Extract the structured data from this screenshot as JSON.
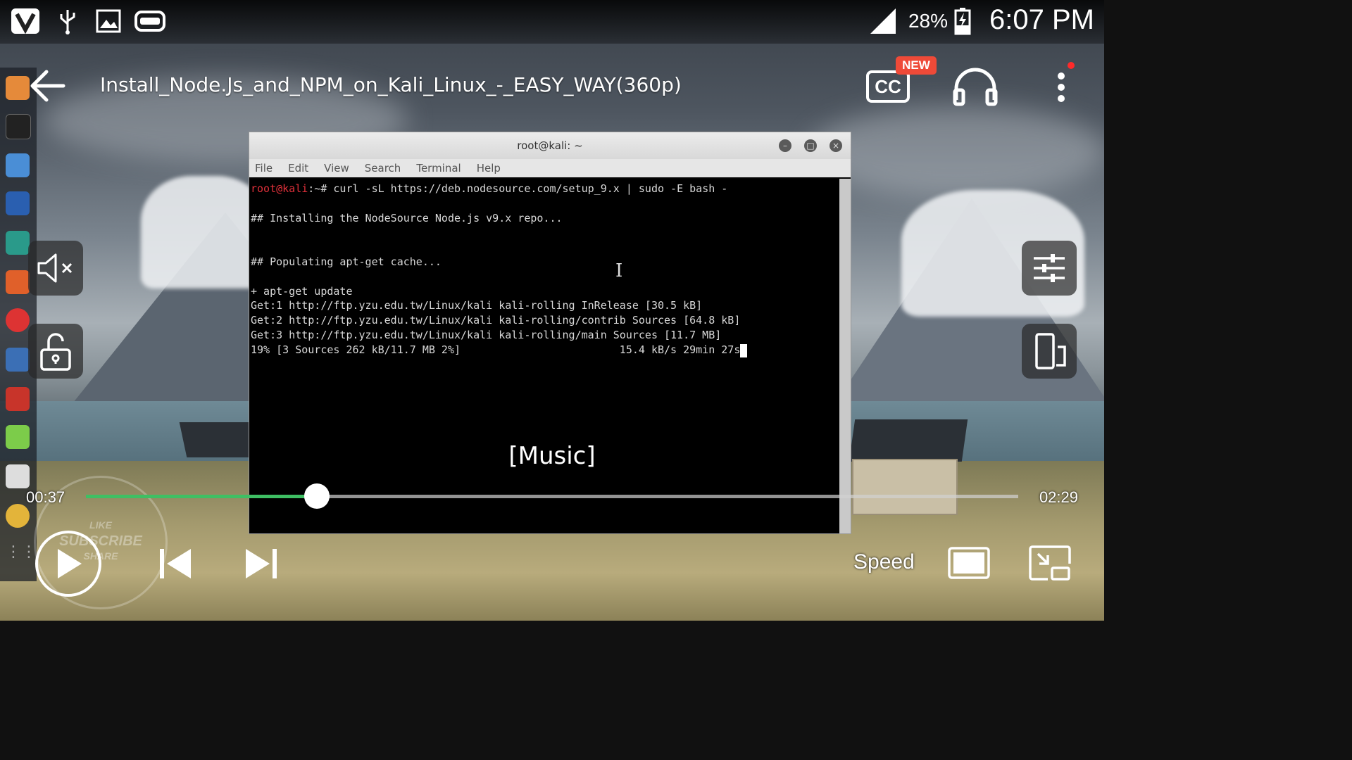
{
  "status_bar": {
    "battery_percent": "28%",
    "time": "6:07 PM",
    "icons": [
      "v-app-icon",
      "usb-icon",
      "image-icon",
      "cast-icon",
      "signal-icon",
      "battery-charging-icon"
    ]
  },
  "header": {
    "title": "Install_Node.Js_and_NPM_on_Kali_Linux_-_EASY_WAY(360p)",
    "cc_label": "CC",
    "new_badge": "NEW"
  },
  "terminal": {
    "title": "root@kali: ~",
    "menu": [
      "File",
      "Edit",
      "View",
      "Search",
      "Terminal",
      "Help"
    ],
    "prompt_user": "root@kali",
    "lines": [
      ":~# curl -sL https://deb.nodesource.com/setup_9.x | sudo -E bash -",
      "",
      "## Installing the NodeSource Node.js v9.x repo...",
      "",
      "",
      "## Populating apt-get cache...",
      "",
      "+ apt-get update",
      "Get:1 http://ftp.yzu.edu.tw/Linux/kali kali-rolling InRelease [30.5 kB]",
      "Get:2 http://ftp.yzu.edu.tw/Linux/kali kali-rolling/contrib Sources [64.8 kB]",
      "Get:3 http://ftp.yzu.edu.tw/Linux/kali kali-rolling/main Sources [11.7 MB]",
      "19% [3 Sources 262 kB/11.7 MB 2%]                         15.4 kB/s 29min 27s"
    ]
  },
  "subtitle": "[Music]",
  "player": {
    "current_time": "00:37",
    "total_time": "02:29",
    "progress_fraction": 0.248,
    "speed_label": "Speed"
  },
  "watermark": {
    "line1": "LIKE",
    "line2": "SUBSCRIBE",
    "line3": "SHARE"
  },
  "colors": {
    "progress": "#3fbf63",
    "new_badge": "#ef4a38",
    "prompt_user": "#e0303a"
  }
}
